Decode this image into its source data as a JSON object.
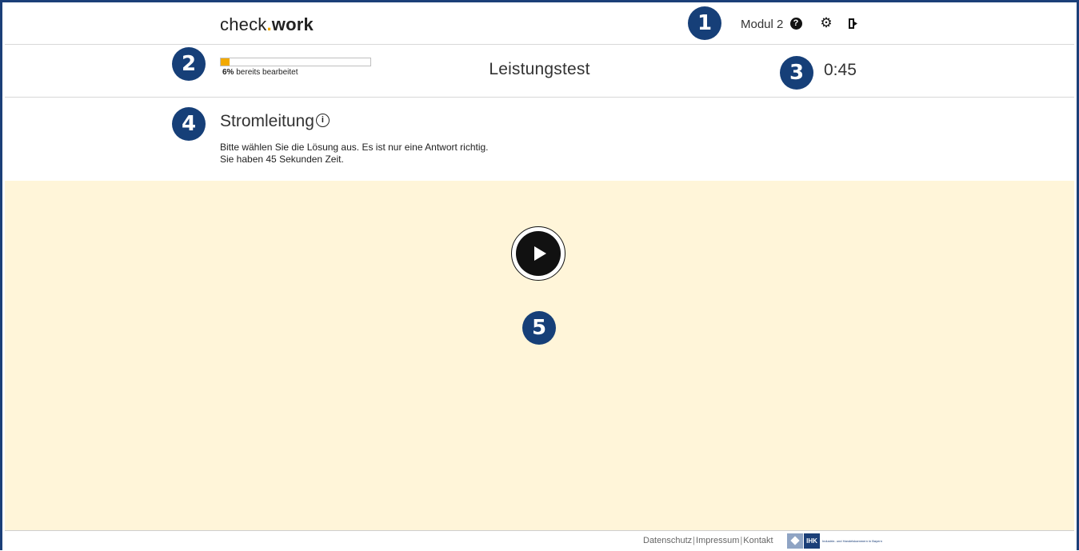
{
  "header": {
    "logo_check": "check",
    "logo_dot": ".",
    "logo_work": "work",
    "module_label": "Modul 2",
    "help_icon": "question-circle-icon",
    "settings_icon": "gear-icon",
    "logout_icon": "sign-out-icon"
  },
  "markers": [
    "1",
    "2",
    "3",
    "4",
    "5"
  ],
  "progress": {
    "percent_label": "6%",
    "label_suffix": "bereits bearbeitet",
    "fraction": 0.06,
    "color": "#f2a900"
  },
  "section_title": "Leistungstest",
  "timer": "0:45",
  "task": {
    "title": "Stromleitung",
    "info_icon": "info-circle-icon",
    "instruction_1": "Bitte wählen Sie die Lösung aus. Es ist nur eine Antwort richtig.",
    "instruction_2": "Sie haben 45 Sekunden Zeit."
  },
  "media": {
    "play_icon": "play-icon",
    "background_color": "#fff5d9"
  },
  "footer": {
    "link_datenschutz": "Datenschutz",
    "link_impressum": "Impressum",
    "link_kontakt": "Kontakt",
    "separator": "|",
    "logo_abbr": "IHK",
    "logo_text": "Industrie- und Handelskammern in Bayern"
  },
  "colors": {
    "brand_blue": "#1b3f78",
    "accent_orange": "#f2a900"
  }
}
